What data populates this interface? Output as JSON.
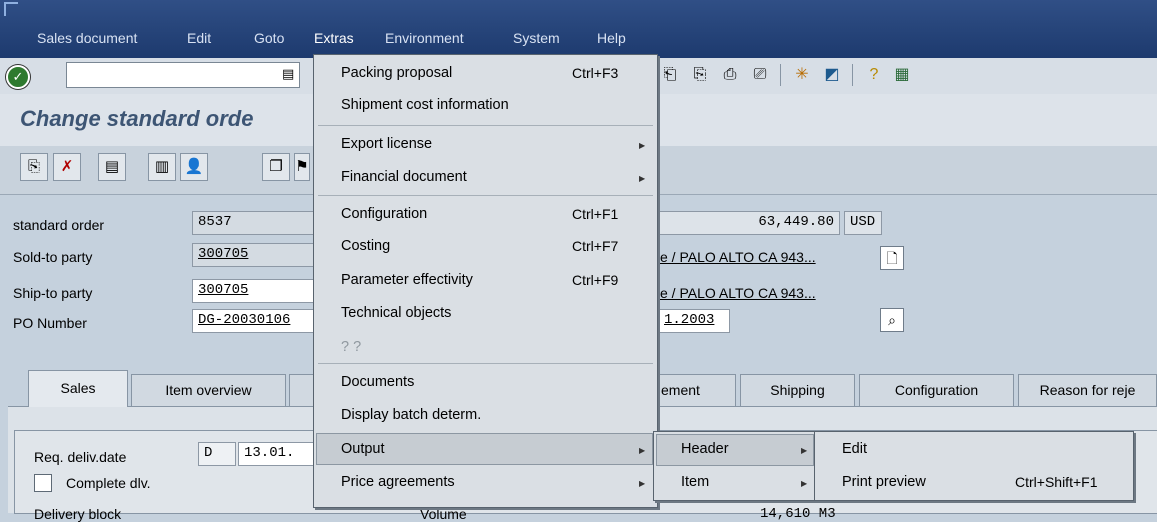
{
  "menubar": {
    "items": [
      "Sales document",
      "Edit",
      "Goto",
      "Extras",
      "Environment",
      "System",
      "Help"
    ]
  },
  "toolbar": {
    "command_value": ""
  },
  "page": {
    "title": "Change standard orde"
  },
  "header": {
    "standard_order_label": "standard order",
    "standard_order_value": "8537",
    "sold_to_label": "Sold-to party",
    "sold_to_value": "300705",
    "ship_to_label": "Ship-to party",
    "ship_to_value": "300705",
    "po_label": "PO Number",
    "po_value": "DG-20030106",
    "net_value": "63,449.80",
    "currency": "USD",
    "sold_to_address": "e / PALO ALTO CA 943...",
    "ship_to_address": "e / PALO ALTO CA 943...",
    "po_date": "1.2003"
  },
  "tabs": {
    "items": [
      "Sales",
      "Item overview",
      "",
      "ement",
      "Shipping",
      "Configuration",
      "Reason for reje"
    ]
  },
  "sales_tab": {
    "req_deliv_label": "Req. deliv.date",
    "req_deliv_type": "D",
    "req_deliv_value": "13.01.",
    "complete_dlv_label": "Complete dlv.",
    "delivery_block_label": "Delivery block",
    "volume_label": "Volume",
    "volume_value": "14,610 M3"
  },
  "extras_menu": {
    "items": [
      {
        "label": "Packing proposal",
        "shortcut": "Ctrl+F3"
      },
      {
        "label": "Shipment cost information",
        "shortcut": ""
      },
      {
        "label": "Export license",
        "shortcut": ""
      },
      {
        "label": "Financial document",
        "shortcut": ""
      },
      {
        "label": "Configuration",
        "shortcut": "Ctrl+F1"
      },
      {
        "label": "Costing",
        "shortcut": "Ctrl+F7"
      },
      {
        "label": "Parameter effectivity",
        "shortcut": "Ctrl+F9"
      },
      {
        "label": "Technical objects",
        "shortcut": ""
      },
      {
        "label": "? ?",
        "shortcut": ""
      },
      {
        "label": "Documents",
        "shortcut": ""
      },
      {
        "label": "Display batch determ.",
        "shortcut": ""
      },
      {
        "label": "Output",
        "shortcut": ""
      },
      {
        "label": "Price agreements",
        "shortcut": ""
      }
    ]
  },
  "output_menu": {
    "items": [
      {
        "label": "Header"
      },
      {
        "label": "Item"
      }
    ]
  },
  "header_menu": {
    "items": [
      {
        "label": "Edit",
        "shortcut": ""
      },
      {
        "label": "Print preview",
        "shortcut": "Ctrl+Shift+F1"
      }
    ]
  },
  "colors": {
    "menubar_bg": "#1d3a6e",
    "title_color": "#3d5574",
    "form_bg": "#c5d1dd"
  }
}
